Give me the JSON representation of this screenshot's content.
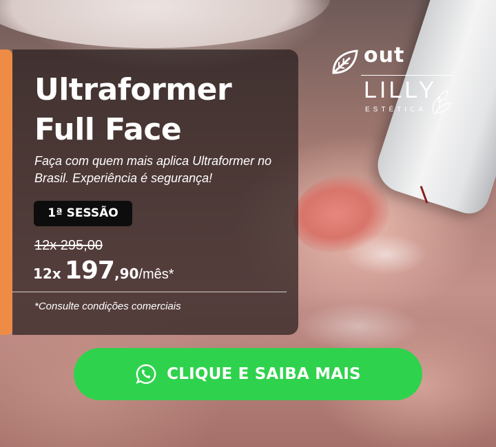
{
  "brand": {
    "logo_top": "out",
    "logo_main": "LILLY",
    "logo_sub": "ESTÉTICA",
    "icon": "leaf-icon"
  },
  "hero": {
    "title": "Ultraformer\nFull Face",
    "subtitle": "Faça com quem mais aplica Ultraformer no Brasil. Experiência é segurança!",
    "badge": "1ª SESSÃO",
    "old_price": "12x 295,00",
    "price_prefix": "12x",
    "price_integer": "197",
    "price_decimal": ",90",
    "price_unit": "/mês*",
    "terms": "*Consulte condições comerciais"
  },
  "cta": {
    "label": "CLIQUE E SAIBA MAIS",
    "icon": "whatsapp-icon"
  },
  "colors": {
    "accent": "#ee8c45",
    "cta_green": "#2fd24c",
    "badge_bg": "#0d0d0d",
    "card_bg": "rgba(40,30,30,0.72)"
  }
}
